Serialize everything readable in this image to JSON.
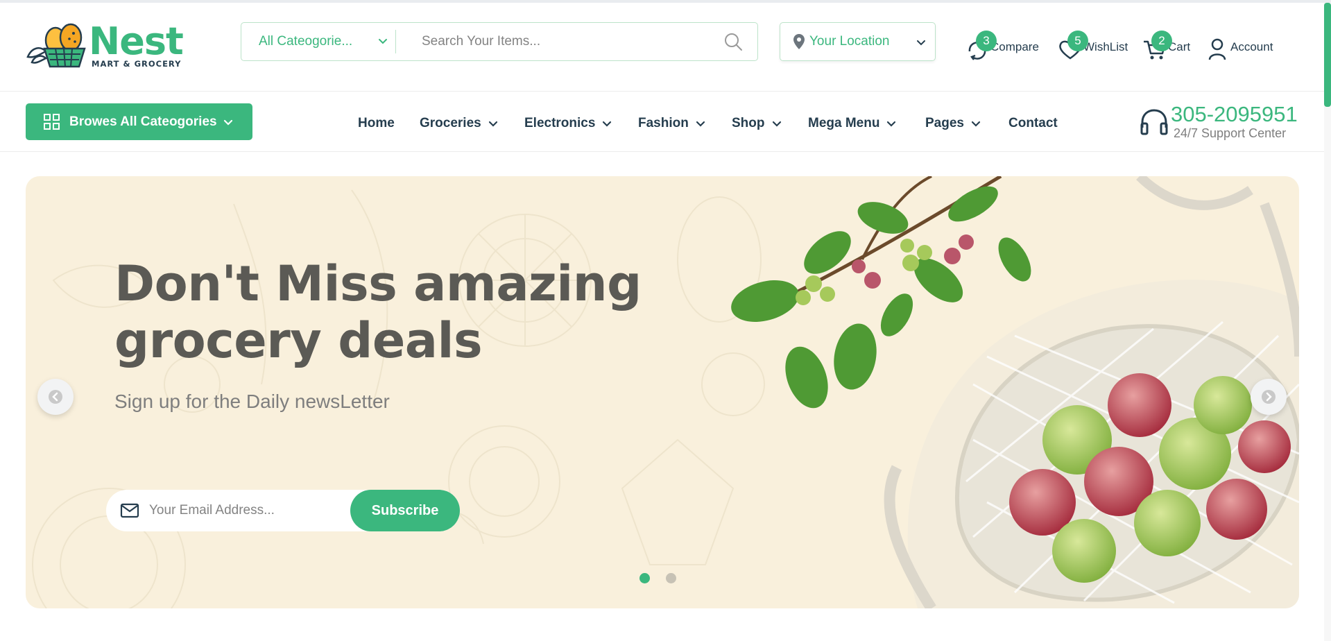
{
  "brand": {
    "name": "Nest",
    "tagline": "MART & GROCERY",
    "accent": "#3bb77e",
    "dark": "#253d4e"
  },
  "search": {
    "category_label": "All Cateogorie...",
    "placeholder": "Search Your Items..."
  },
  "location": {
    "label": "Your Location"
  },
  "header_actions": [
    {
      "label": "Compare",
      "count": "3",
      "icon": "compare-icon"
    },
    {
      "label": "WishList",
      "count": "5",
      "icon": "heart-icon"
    },
    {
      "label": "Cart",
      "count": "2",
      "icon": "cart-icon"
    },
    {
      "label": "Account",
      "icon": "user-icon"
    }
  ],
  "nav": {
    "browse_label": "Browes All Cateogories",
    "items": [
      {
        "label": "Home",
        "dropdown": false
      },
      {
        "label": "Groceries",
        "dropdown": true
      },
      {
        "label": "Electronics",
        "dropdown": true
      },
      {
        "label": "Fashion",
        "dropdown": true
      },
      {
        "label": "Shop",
        "dropdown": true
      },
      {
        "label": "Mega Menu",
        "dropdown": true
      },
      {
        "label": "Pages",
        "dropdown": true
      },
      {
        "label": "Contact",
        "dropdown": false
      }
    ]
  },
  "support": {
    "phone": "305-2095951",
    "label": "24/7 Support Center"
  },
  "hero": {
    "title_line1": "Don't Miss amazing",
    "title_line2": "grocery deals",
    "subtitle": "Sign up for the Daily newsLetter",
    "email_placeholder": "Your Email Address...",
    "subscribe_label": "Subscribe",
    "slide_count": 2,
    "active_slide": 1,
    "background_color": "#f9f0dc"
  }
}
